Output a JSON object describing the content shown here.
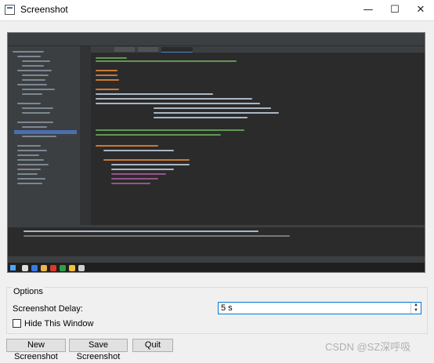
{
  "window": {
    "title": "Screenshot",
    "minimize_glyph": "—",
    "maximize_glyph": "☐",
    "close_glyph": "✕"
  },
  "options": {
    "group_title": "Options",
    "delay_label": "Screenshot Delay:",
    "delay_value": "5 s",
    "hide_label": "Hide This Window",
    "hide_checked": false
  },
  "buttons": {
    "new": "New Screenshot",
    "save": "Save Screenshot",
    "quit": "Quit"
  },
  "watermark": "CSDN @SZ深呼吸",
  "colors": {
    "ide_background": "#2b2b2b",
    "ide_panel": "#3c3f41",
    "focus_border": "#0078d7"
  }
}
